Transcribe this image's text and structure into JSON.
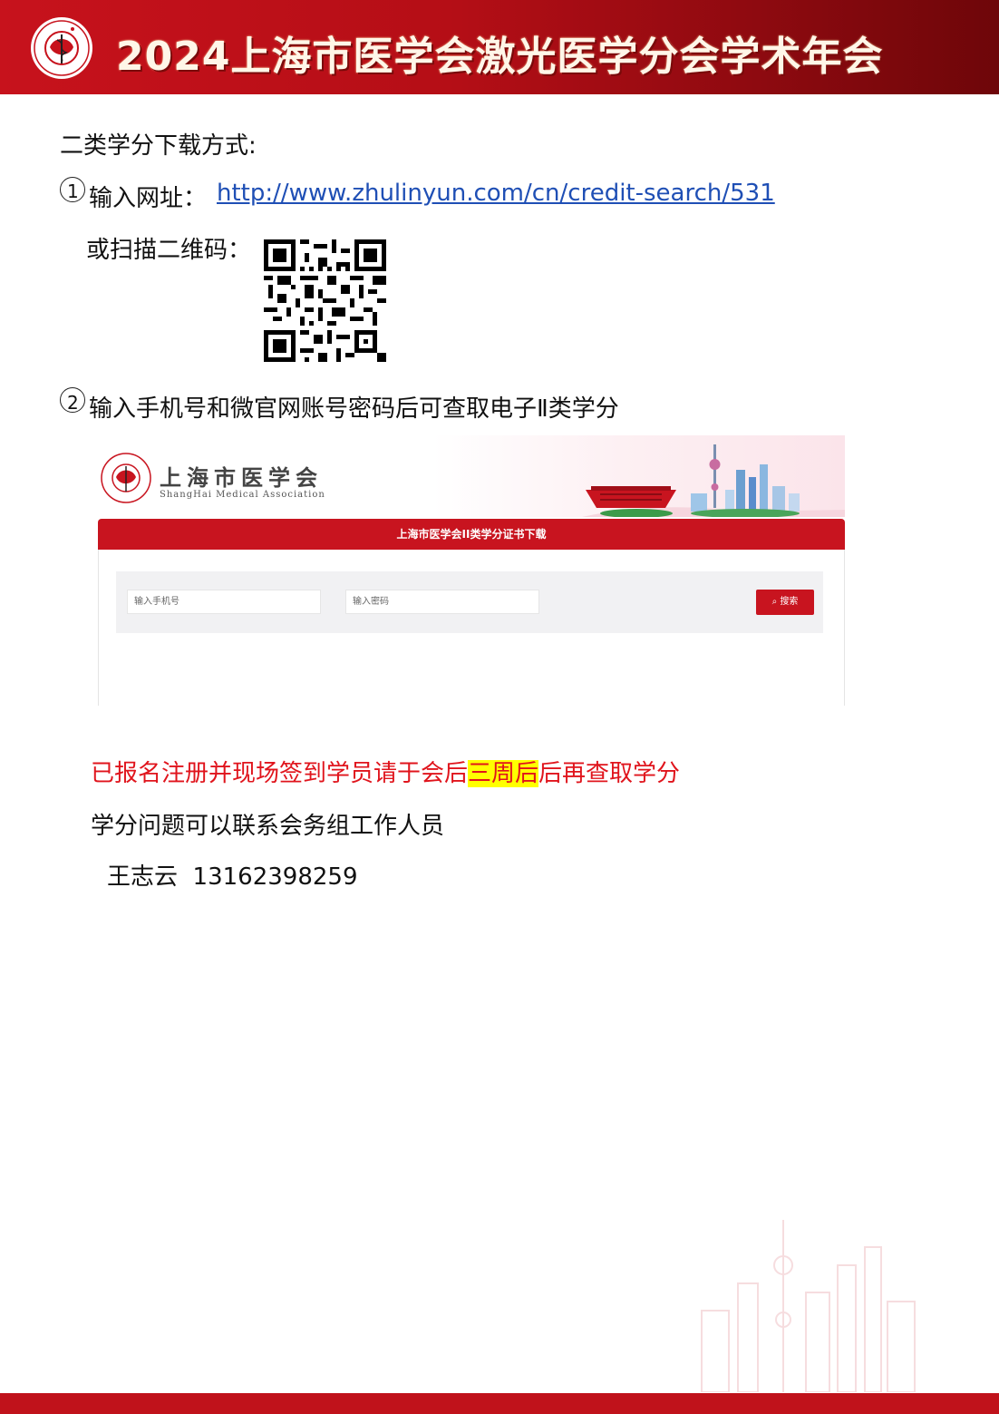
{
  "banner": {
    "title": "2024上海市医学会激光医学分会学术年会",
    "logo_text": "上海市医学会 SHANGHAI MEDICAL ASSOCIATION"
  },
  "heading": "二类学分下载方式:",
  "step1": {
    "number": "1",
    "label": "输入网址：",
    "url": "http://www.zhulinyun.com/cn/credit-search/531",
    "qr_label": "或扫描二维码："
  },
  "step2": {
    "number": "2",
    "label": "输入手机号和微官网账号密码后可查取电子Ⅱ类学分"
  },
  "screenshot": {
    "org_name": "上海市医学会",
    "org_name_en": "ShangHai Medical Association",
    "bar_title": "上海市医学会II类学分证书下载",
    "phone_placeholder": "输入手机号",
    "password_placeholder": "输入密码",
    "search_label": "搜索"
  },
  "notice": {
    "part1": "已报名注册并现场签到学员请于会后",
    "highlight": "三周后",
    "part2": "后再查取学分"
  },
  "contact": {
    "line": "学分问题可以联系会务组工作人员",
    "name": "王志云",
    "phone": "13162398259"
  },
  "colors": {
    "brand_red": "#c8141f",
    "link_blue": "#1f4fb5",
    "notice_red": "#e0141c",
    "highlight": "#ffff00"
  }
}
